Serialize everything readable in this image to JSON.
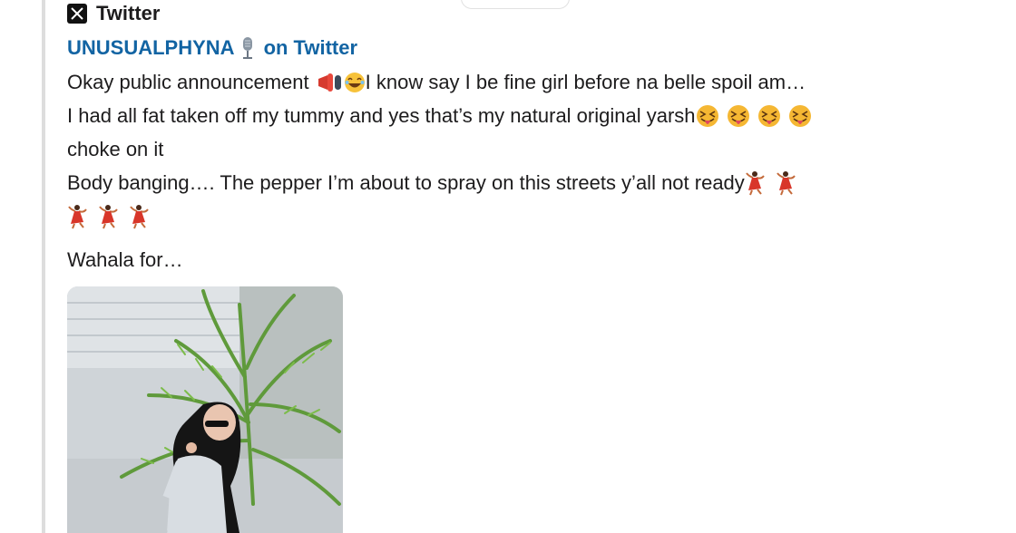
{
  "service": {
    "name": "Twitter",
    "logo_icon": "x-logo-icon"
  },
  "author": {
    "name": "UNUSUALPHYNA",
    "suffix": "on Twitter",
    "emoji_icon": "microphone-icon"
  },
  "post": {
    "line1_text": "Okay public announcement",
    "line1_rest": " I know say I be fine girl before na belle spoil am…",
    "line2_text": "I had all fat taken off my tummy and yes that’s my natural original yarsh",
    "line3_text": "choke on it",
    "line4_text": "Body banging…. The pepper I’m about to spray on this streets y’all not ready ",
    "line6_text": "Wahala for…"
  },
  "colors": {
    "author_link": "#1264a3",
    "text": "#1d1c1d",
    "quote_bar": "#dddddd"
  }
}
